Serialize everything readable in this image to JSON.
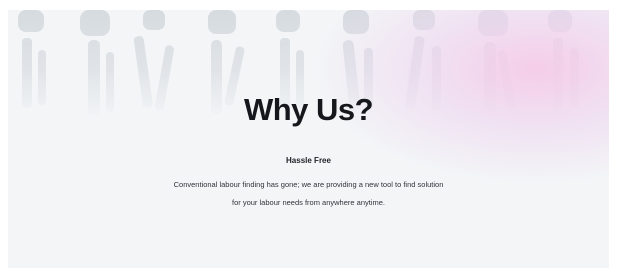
{
  "section": {
    "title": "Why Us?",
    "subtitle": "Hassle Free",
    "description_lines": [
      "Conventional labour finding has gone; we are providing a new tool to find solution",
      "for your labour needs from anywhere anytime."
    ]
  },
  "colors": {
    "background": "#f3f5f7",
    "title": "#15171c",
    "accent_glow": "#f5cbe8"
  }
}
